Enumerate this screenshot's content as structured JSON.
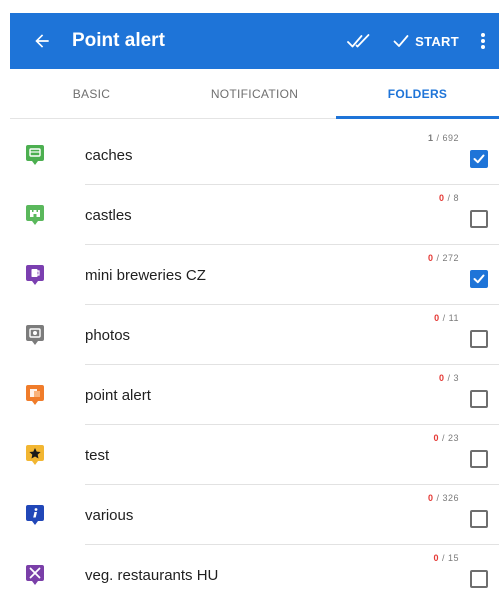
{
  "appbar": {
    "title": "Point alert",
    "start_label": "START",
    "color": "#1e74d8"
  },
  "tabs": [
    {
      "label": "BASIC",
      "active": false
    },
    {
      "label": "NOTIFICATION",
      "active": false
    },
    {
      "label": "FOLDERS",
      "active": true
    }
  ],
  "folders": [
    {
      "name": "caches",
      "selected": "1",
      "total": "/ 692",
      "checked": true,
      "icon": "cache-marker-icon",
      "color": "#4caf50"
    },
    {
      "name": "castles",
      "selected": "0",
      "total": "/ 8",
      "checked": false,
      "icon": "castle-marker-icon",
      "color": "#5ab85c"
    },
    {
      "name": "mini breweries CZ",
      "selected": "0",
      "total": "/ 272",
      "checked": true,
      "icon": "brewery-marker-icon",
      "color": "#7b3fb0"
    },
    {
      "name": "photos",
      "selected": "0",
      "total": "/ 11",
      "checked": false,
      "icon": "photo-marker-icon",
      "color": "#7c7c7c"
    },
    {
      "name": "point alert",
      "selected": "0",
      "total": "/ 3",
      "checked": false,
      "icon": "alert-marker-icon",
      "color": "#f07c2a"
    },
    {
      "name": "test",
      "selected": "0",
      "total": "/ 23",
      "checked": false,
      "icon": "star-marker-icon",
      "color": "#f2b632"
    },
    {
      "name": "various",
      "selected": "0",
      "total": "/ 326",
      "checked": false,
      "icon": "info-marker-icon",
      "color": "#2147b8"
    },
    {
      "name": "veg. restaurants HU",
      "selected": "0",
      "total": "/ 15",
      "checked": false,
      "icon": "restaurant-marker-icon",
      "color": "#7a3fa8"
    }
  ]
}
